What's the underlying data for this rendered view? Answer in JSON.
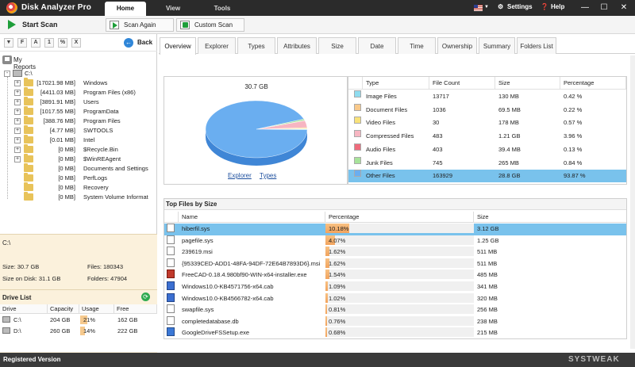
{
  "app": {
    "title": "Disk Analyzer Pro",
    "tabs": [
      "Home",
      "View",
      "Tools"
    ],
    "settings_label": "Settings",
    "help_label": "Help"
  },
  "toolbar": {
    "start_scan": "Start Scan",
    "scan_again": "Scan Again",
    "custom_scan": "Custom Scan"
  },
  "left": {
    "filter_buttons": [
      "F",
      "A",
      "1",
      "%",
      "X"
    ],
    "back": "Back",
    "my_reports": "My Reports",
    "root": "C:\\",
    "tree": [
      {
        "size": "[17021.98 MB]",
        "name": "Windows",
        "expand": "+"
      },
      {
        "size": "[4411.03 MB]",
        "name": "Program Files (x86)",
        "expand": "+"
      },
      {
        "size": "[3891.91 MB]",
        "name": "Users",
        "expand": "+"
      },
      {
        "size": "[1017.55 MB]",
        "name": "ProgramData",
        "expand": "+"
      },
      {
        "size": "[388.76 MB]",
        "name": "Program Files",
        "expand": "+"
      },
      {
        "size": "[4.77 MB]",
        "name": "SWTOOLS",
        "expand": "+"
      },
      {
        "size": "[0.01 MB]",
        "name": "Intel",
        "expand": "+"
      },
      {
        "size": "[0 MB]",
        "name": "$Recycle.Bin",
        "expand": "+"
      },
      {
        "size": "[0 MB]",
        "name": "$WinREAgent",
        "expand": "+"
      },
      {
        "size": "[0 MB]",
        "name": "Documents and Settings",
        "expand": ""
      },
      {
        "size": "[0 MB]",
        "name": "PerfLogs",
        "expand": ""
      },
      {
        "size": "[0 MB]",
        "name": "Recovery",
        "expand": ""
      },
      {
        "size": "[0 MB]",
        "name": "System Volume Informat",
        "expand": ""
      }
    ],
    "selected_path": "C:\\",
    "size": "Size: 30.7 GB",
    "size_on_disk": "Size on Disk: 31.1 GB",
    "files": "Files: 180343",
    "folders": "Folders: 47904",
    "drive_list_title": "Drive List",
    "drive_headers": [
      "Drive",
      "Capacity",
      "Usage",
      "Free"
    ],
    "drives": [
      {
        "drive": "C:\\",
        "capacity": "204 GB",
        "usage": "21%",
        "usage_pct": 21,
        "free": "162 GB"
      },
      {
        "drive": "D:\\",
        "capacity": "260 GB",
        "usage": "14%",
        "usage_pct": 14,
        "free": "222 GB"
      }
    ]
  },
  "tabs": [
    "Overview",
    "Explorer",
    "Types",
    "Attributes",
    "Size",
    "Date",
    "Time",
    "Ownership",
    "Summary",
    "Folders List"
  ],
  "overview": {
    "pie_total": "30.7 GB",
    "links": [
      "Explorer",
      "Types"
    ],
    "headers": [
      "Type",
      "File Count",
      "Size",
      "Percentage"
    ],
    "rows": [
      {
        "type": "Image Files",
        "count": "13717",
        "size": "130 MB",
        "pct": "0.42 %",
        "color": "#8fdcef"
      },
      {
        "type": "Document Files",
        "count": "1036",
        "size": "69.5 MB",
        "pct": "0.22 %",
        "color": "#f9c98b"
      },
      {
        "type": "Video Files",
        "count": "30",
        "size": "178 MB",
        "pct": "0.57 %",
        "color": "#f9e27a"
      },
      {
        "type": "Compressed Files",
        "count": "483",
        "size": "1.21 GB",
        "pct": "3.96 %",
        "color": "#f7b6c2"
      },
      {
        "type": "Audio Files",
        "count": "403",
        "size": "39.4 MB",
        "pct": "0.13 %",
        "color": "#ef6b7c"
      },
      {
        "type": "Junk Files",
        "count": "745",
        "size": "265 MB",
        "pct": "0.84 %",
        "color": "#a7e39a"
      },
      {
        "type": "Other Files",
        "count": "163929",
        "size": "28.8 GB",
        "pct": "93.87 %",
        "color": "#6aaef0"
      }
    ]
  },
  "top_files": {
    "title": "Top Files by Size",
    "headers": [
      "Name",
      "Percentage",
      "Size"
    ],
    "rows": [
      {
        "name": "hiberfil.sys",
        "pct": "10.18%",
        "pct_val": 10.18,
        "size": "3.12 GB",
        "icon": "file"
      },
      {
        "name": "pagefile.sys",
        "pct": "4.07%",
        "pct_val": 4.07,
        "size": "1.25 GB",
        "icon": "file"
      },
      {
        "name": "239619.msi",
        "pct": "1.62%",
        "pct_val": 1.62,
        "size": "511 MB",
        "icon": "msi"
      },
      {
        "name": "{95339CED-ADD1-48FA-94DF-72E64B7893D6}.msi",
        "pct": "1.62%",
        "pct_val": 1.62,
        "size": "511 MB",
        "icon": "msi"
      },
      {
        "name": "FreeCAD-0.18.4.980bf90-WIN-x64-installer.exe",
        "pct": "1.54%",
        "pct_val": 1.54,
        "size": "485 MB",
        "icon": "inst"
      },
      {
        "name": "Windows10.0-KB4571756-x64.cab",
        "pct": "1.09%",
        "pct_val": 1.09,
        "size": "341 MB",
        "icon": "cab"
      },
      {
        "name": "Windows10.0-KB4566782-x64.cab",
        "pct": "1.02%",
        "pct_val": 1.02,
        "size": "320 MB",
        "icon": "cab"
      },
      {
        "name": "swapfile.sys",
        "pct": "0.81%",
        "pct_val": 0.81,
        "size": "256 MB",
        "icon": "file"
      },
      {
        "name": "completedatabase.db",
        "pct": "0.76%",
        "pct_val": 0.76,
        "size": "238 MB",
        "icon": "file"
      },
      {
        "name": "GoogleDriveFSSetup.exe",
        "pct": "0.68%",
        "pct_val": 0.68,
        "size": "215 MB",
        "icon": "gd"
      }
    ]
  },
  "status": {
    "text": "Registered Version",
    "watermark": "SYSTWEAK"
  },
  "colors": {
    "accent": "#2f86d8",
    "selection": "#79c2ec",
    "bar": "#f2a35d"
  }
}
